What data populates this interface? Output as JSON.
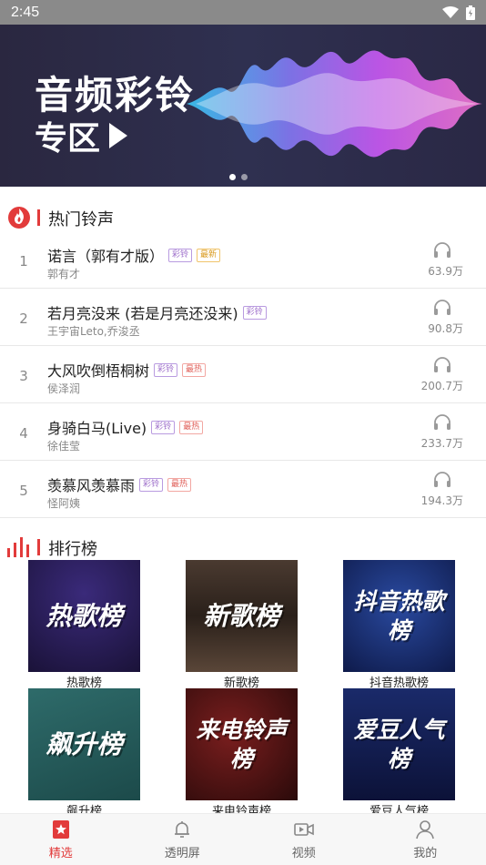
{
  "status_bar": {
    "time": "2:45"
  },
  "banner": {
    "title": "音频彩铃",
    "subtitle": "专区"
  },
  "hot_section": {
    "title": "热门铃声"
  },
  "songs": [
    {
      "rank": "1",
      "title": "诺言（郭有才版）",
      "artist": "郭有才",
      "count": "63.9万",
      "tags": [
        "彩铃",
        "最新"
      ]
    },
    {
      "rank": "2",
      "title": "若月亮没来 (若是月亮还没来)",
      "artist": "王宇宙Leto,乔浚丞",
      "count": "90.8万",
      "tags": [
        "彩铃"
      ]
    },
    {
      "rank": "3",
      "title": "大风吹倒梧桐树",
      "artist": "侯泽润",
      "count": "200.7万",
      "tags": [
        "彩铃",
        "最热"
      ]
    },
    {
      "rank": "4",
      "title": "身骑白马(Live)",
      "artist": "徐佳莹",
      "count": "233.7万",
      "tags": [
        "彩铃",
        "最热"
      ]
    },
    {
      "rank": "5",
      "title": "羡慕风羡慕雨",
      "artist": "怪阿姨",
      "count": "194.3万",
      "tags": [
        "彩铃",
        "最热"
      ]
    }
  ],
  "rank_section": {
    "title": "排行榜"
  },
  "charts": [
    {
      "label": "热歌榜",
      "cover_text": "热歌榜"
    },
    {
      "label": "新歌榜",
      "cover_text": "新歌榜"
    },
    {
      "label": "抖音热歌榜",
      "cover_text": "抖音热歌榜"
    },
    {
      "label": "飙升榜",
      "cover_text": "飙升榜"
    },
    {
      "label": "来电铃声榜",
      "cover_text": "来电铃声榜"
    },
    {
      "label": "爱豆人气榜",
      "cover_text": "爱豆人气榜"
    }
  ],
  "bottom_nav": [
    {
      "label": "精选",
      "icon": "star-bookmark-icon",
      "active": true
    },
    {
      "label": "透明屏",
      "icon": "bell-icon",
      "active": false
    },
    {
      "label": "视频",
      "icon": "video-icon",
      "active": false
    },
    {
      "label": "我的",
      "icon": "person-icon",
      "active": false
    }
  ],
  "colors": {
    "accent": "#e23b3b",
    "tag_ring": "#9b6bc9",
    "tag_new": "#d99a1e",
    "tag_hot": "#e0605a"
  }
}
